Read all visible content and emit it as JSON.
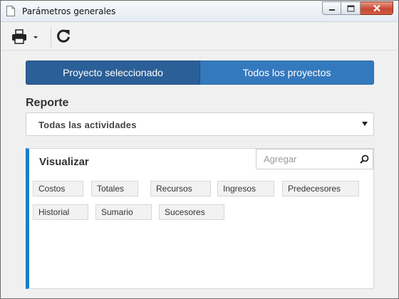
{
  "window": {
    "title": "Parámetros generales",
    "controls": {
      "minimize": "minimize",
      "maximize": "maximize",
      "close": "close"
    }
  },
  "toolbar": {
    "print_icon": "printer-icon",
    "refresh_icon": "refresh-icon"
  },
  "tabs": [
    {
      "label": "Proyecto seleccionado",
      "active": true
    },
    {
      "label": "Todos los proyectos",
      "active": false
    }
  ],
  "report": {
    "label": "Reporte",
    "selected": "Todas las actividades"
  },
  "visualize": {
    "title": "Visualizar",
    "search_placeholder": "Agregar",
    "items": [
      "Costos",
      "Totales",
      "Recursos",
      "Ingresos",
      "Predecesores",
      "Historial",
      "Sumario",
      "Sucesores"
    ]
  },
  "colors": {
    "tab_active": "#2b5f97",
    "tab_inactive": "#3479be",
    "panel_accent": "#1b7ec2",
    "close_button": "#c84a35"
  }
}
